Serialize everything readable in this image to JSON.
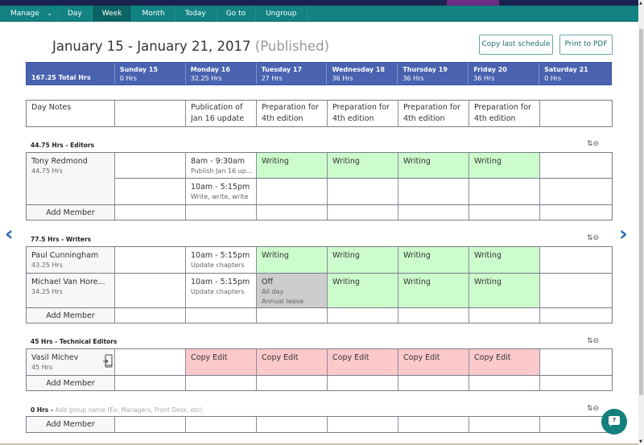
{
  "navbar": {
    "items": [
      {
        "label": "Manage"
      },
      {
        "label": "Day"
      },
      {
        "label": "Week",
        "active": true
      },
      {
        "label": "Month"
      },
      {
        "label": "Today"
      },
      {
        "label": "Go to"
      },
      {
        "label": "Ungroup"
      }
    ],
    "manage_chevron": "⌄"
  },
  "header": {
    "date_range": "January 15 - January 21, 2017",
    "status": "(Published)",
    "copy_button": "Copy last schedule",
    "print_button": "Print to PDF"
  },
  "summary_row": {
    "total": "167.25 Total Hrs",
    "days": [
      {
        "day": "Sunday 15",
        "hours": "0 Hrs"
      },
      {
        "day": "Monday 16",
        "hours": "32.25 Hrs"
      },
      {
        "day": "Tuesday 17",
        "hours": "27 Hrs"
      },
      {
        "day": "Wednesday 18",
        "hours": "36 Hrs"
      },
      {
        "day": "Thursday 19",
        "hours": "36 Hrs"
      },
      {
        "day": "Friday 20",
        "hours": "36 Hrs"
      },
      {
        "day": "Saturday 21",
        "hours": "0 Hrs"
      }
    ]
  },
  "day_notes": {
    "label": "Day Notes",
    "notes": [
      "",
      "Publication of Jan 16 update",
      "Preparation for 4th edition",
      "Preparation for 4th edition",
      "Preparation for 4th edition",
      "Preparation for 4th edition",
      ""
    ]
  },
  "add_member_label": "Add Member",
  "group_controls": {
    "sort_icon": "⇅",
    "collapse_icon": "⊖"
  },
  "groups": [
    {
      "hours": "44.75 Hrs",
      "name": "Editors",
      "members": [
        {
          "name": "Tony Redmond",
          "hours": "44.75 Hrs",
          "rows": [
            [
              null,
              {
                "main": "8am - 9:30am",
                "sub": "Publish Jan 16 up..."
              },
              {
                "main": "Writing",
                "color": "green"
              },
              {
                "main": "Writing",
                "color": "green"
              },
              {
                "main": "Writing",
                "color": "green"
              },
              {
                "main": "Writing",
                "color": "green"
              },
              null
            ],
            [
              null,
              {
                "main": "10am - 5:15pm",
                "sub": "Write, write, write"
              },
              null,
              null,
              null,
              null,
              null
            ]
          ]
        }
      ]
    },
    {
      "hours": "77.5 Hrs",
      "name": "Writers",
      "members": [
        {
          "name": "Paul Cunningham",
          "hours": "43.25 Hrs",
          "rows": [
            [
              null,
              {
                "main": "10am - 5:15pm",
                "sub": "Update chapters"
              },
              {
                "main": "Writing",
                "color": "green"
              },
              {
                "main": "Writing",
                "color": "green"
              },
              {
                "main": "Writing",
                "color": "green"
              },
              {
                "main": "Writing",
                "color": "green"
              },
              null
            ]
          ]
        },
        {
          "name": "Michael Van Hore...",
          "hours": "34.25 Hrs",
          "rows": [
            [
              null,
              {
                "main": "10am - 5:15pm",
                "sub": "Update chapters"
              },
              {
                "main": "Off",
                "sub": "All day",
                "sub2": "Annual leave",
                "color": "gray"
              },
              {
                "main": "Writing",
                "color": "green"
              },
              {
                "main": "Writing",
                "color": "green"
              },
              {
                "main": "Writing",
                "color": "green"
              },
              null
            ]
          ]
        }
      ]
    },
    {
      "hours": "45 Hrs",
      "name": "Technical Editors",
      "members": [
        {
          "name": "Vasil Michev",
          "hours": "45 Hrs",
          "device_icon": true,
          "rows": [
            [
              null,
              {
                "main": "Copy Edit",
                "color": "pink"
              },
              {
                "main": "Copy Edit",
                "color": "pink"
              },
              {
                "main": "Copy Edit",
                "color": "pink"
              },
              {
                "main": "Copy Edit",
                "color": "pink"
              },
              {
                "main": "Copy Edit",
                "color": "pink"
              },
              null
            ]
          ]
        }
      ]
    },
    {
      "hours": "0 Hrs",
      "name": "",
      "placeholder": "Add group name (Ex: Managers, Front Desk, etc)",
      "members": []
    }
  ],
  "colors": {
    "navbar": "#128282",
    "header_row": "#4963b0",
    "shift_green": "#ccfccc",
    "shift_pink": "#fcc9cb",
    "time_off_gray": "#cdcdcd",
    "accent_teal": "#13807c"
  },
  "help_button": "?",
  "nav_prev": "‹",
  "nav_next": "›"
}
